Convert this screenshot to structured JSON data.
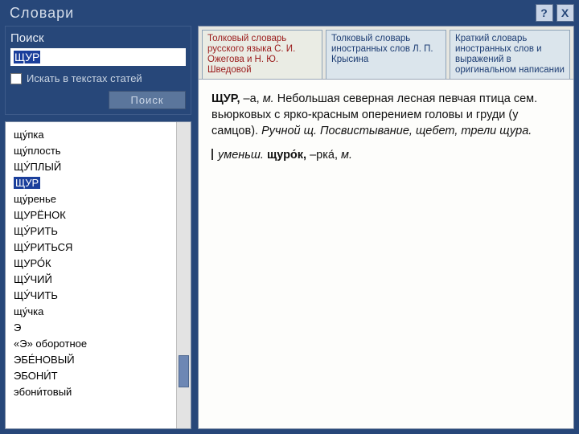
{
  "titlebar": {
    "title": "Словари",
    "help": "?",
    "close": "X"
  },
  "search": {
    "label": "Поиск",
    "value": "ЩУР",
    "checkbox_label": "Искать в текстах статей",
    "button": "Поиск"
  },
  "wordlist": {
    "items": [
      "щу́пка",
      "щу́плость",
      "ЩУ́ПЛЫЙ",
      "ЩУР",
      "щу́ренье",
      "ЩУРЁНОК",
      "ЩУ́РИТЬ",
      "ЩУ́РИТЬСЯ",
      "ЩУРО́К",
      "ЩУ́ЧИЙ",
      "ЩУ́ЧИТЬ",
      "щу́чка",
      "Э",
      "«Э» оборотное",
      "ЭБЕ́НОВЫЙ",
      "ЭБОНИ́Т",
      "эбони́товый"
    ],
    "selected_index": 3
  },
  "tabs": [
    {
      "label": "Толковый словарь русского языка С. И. Ожегова и Н. Ю. Шведовой",
      "active": true
    },
    {
      "label": "Толковый словарь иностранных слов Л. П. Крысина",
      "active": false
    },
    {
      "label": "Краткий словарь иностранных слов и выражений в оригинальном написании",
      "active": false
    }
  ],
  "article": {
    "headword": "ЩУР,",
    "gram1": " –а, ",
    "pos1": "м.",
    "def": " Небольшая северная лесная певчая птица сем. вьюрковых с ярко-красным оперением головы и груди (у самцов). ",
    "ex_it": "Ручной щ. Посвистывание, щебет, трели щура.",
    "dim_lead": "уменьш.",
    "dim_word": " щуро́к, ",
    "dim_gram": "–рка́, ",
    "dim_pos": "м."
  }
}
